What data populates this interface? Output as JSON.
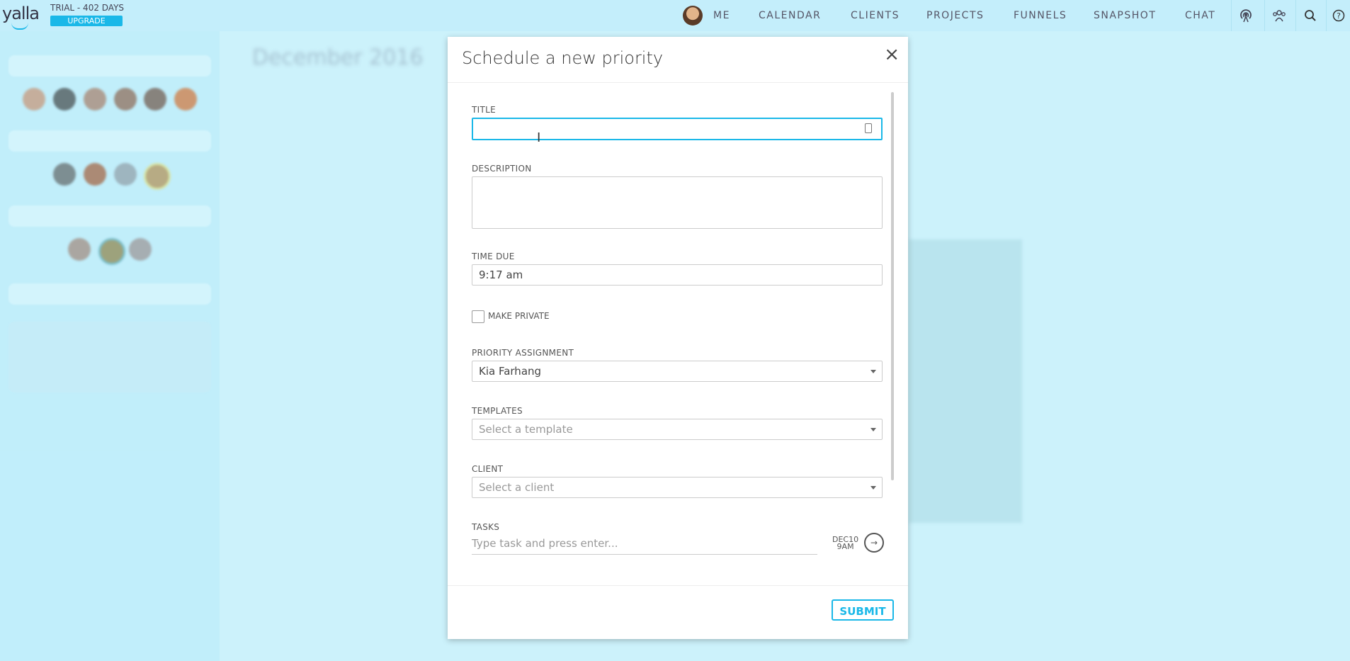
{
  "app": {
    "logo": "yalla",
    "trial_text": "TRIAL - 402 DAYS",
    "upgrade_label": "UPGRADE"
  },
  "nav": {
    "items": [
      "ME",
      "CALENDAR",
      "CLIENTS",
      "PROJECTS",
      "FUNNELS",
      "SNAPSHOT",
      "CHAT"
    ],
    "icons": [
      "broadcast-icon",
      "team-icon",
      "search-icon",
      "help-icon"
    ]
  },
  "calendar": {
    "month_title": "December 2016"
  },
  "modal": {
    "title": "Schedule a new priority",
    "close_glyph": "×",
    "fields": {
      "title_label": "TITLE",
      "title_value": "",
      "description_label": "DESCRIPTION",
      "description_value": "",
      "time_due_label": "TIME DUE",
      "time_due_value": "9:17 am",
      "make_private_label": "MAKE PRIVATE",
      "priority_assignment_label": "PRIORITY ASSIGNMENT",
      "priority_assignment_value": "Kia Farhang",
      "templates_label": "TEMPLATES",
      "templates_placeholder": "Select a template",
      "client_label": "CLIENT",
      "client_placeholder": "Select a client",
      "tasks_label": "TASKS",
      "tasks_placeholder": "Type task and press enter..."
    },
    "due_badge": {
      "date": "DEC10",
      "time": "9AM"
    },
    "submit_label": "SUBMIT"
  },
  "colors": {
    "accent": "#1ab8e8",
    "topbar": "#c4eefb",
    "background": "#d3f3fb"
  }
}
